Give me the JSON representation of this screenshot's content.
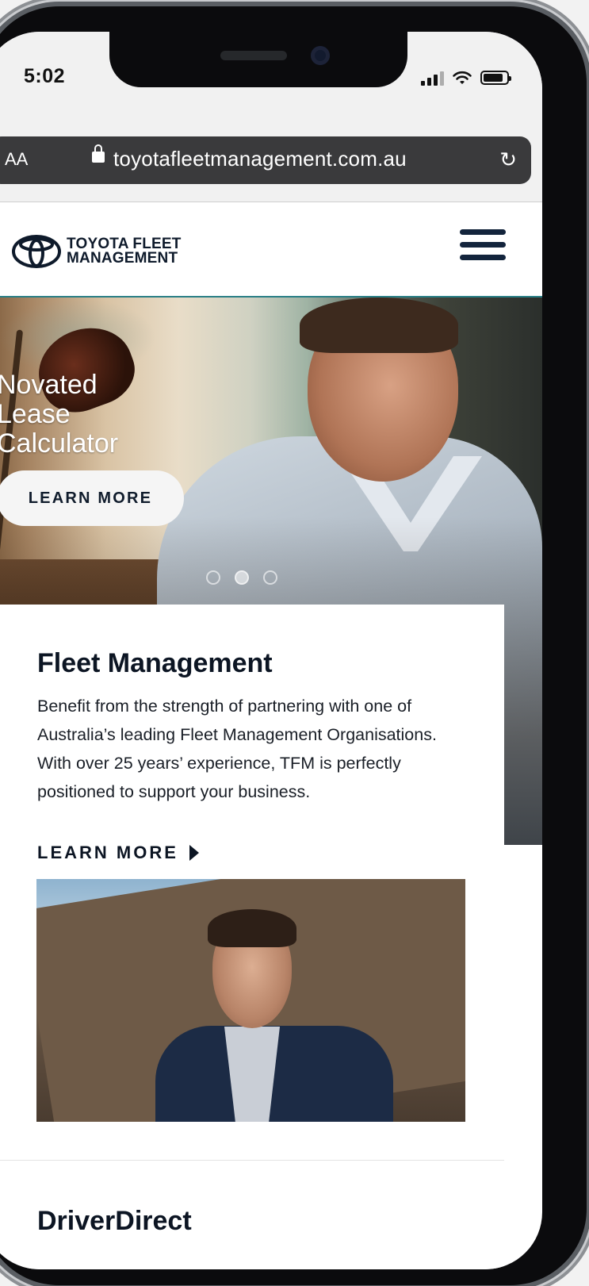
{
  "status_bar": {
    "time": "5:02"
  },
  "browser": {
    "text_size_label": "AA",
    "url": "toyotafleetmanagement.com.au",
    "reload_glyph": "↻"
  },
  "site": {
    "logo_line1": "TOYOTA FLEET",
    "logo_line2": "MANAGEMENT"
  },
  "hero": {
    "title_line1": "Novated",
    "title_line2": "Lease",
    "title_line3": "Calculator",
    "button_label": "LEARN MORE",
    "slides": 3,
    "active_slide": 1
  },
  "fleet_card": {
    "title": "Fleet Management",
    "body": "Benefit from the strength of partnering with one of Australia’s leading Fleet Management Organisations. With over 25 years’ experience, TFM is perfectly positioned to support your business.",
    "link_label": "LEARN MORE"
  },
  "next_section": {
    "title": "DriverDirect"
  },
  "colors": {
    "brand_navy": "#13243c",
    "header_rule": "#2a7f86",
    "address_bar": "#3a3a3c"
  },
  "icons": [
    "lock-icon",
    "reload-icon",
    "toyota-logo-icon",
    "hamburger-menu-icon",
    "triangle-right-icon"
  ]
}
